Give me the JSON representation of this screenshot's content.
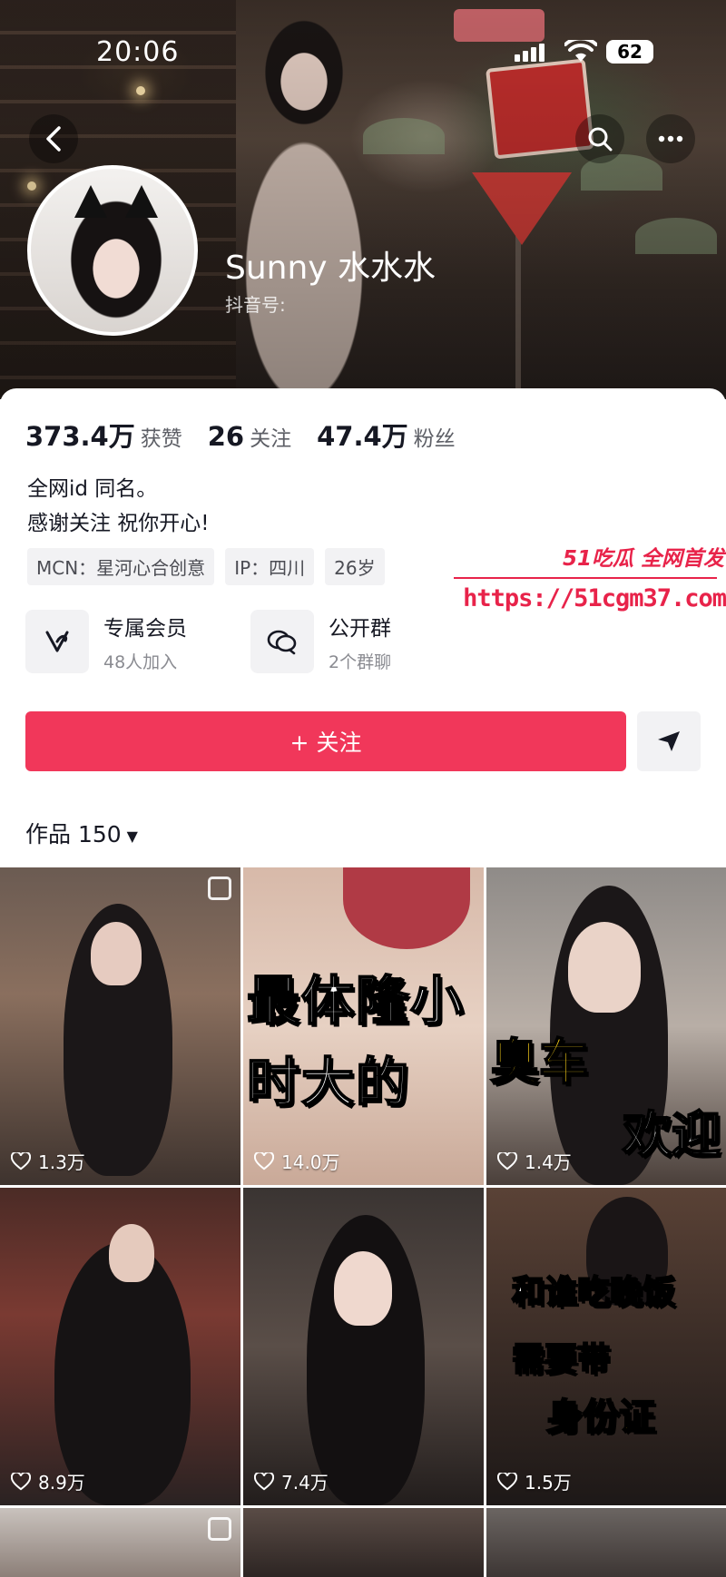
{
  "status_bar": {
    "time": "20:06",
    "battery": "62"
  },
  "profile": {
    "name": "Sunny 水水水",
    "douyin_id_label": "抖音号:",
    "stats": [
      {
        "value": "373.4万",
        "label": "获赞"
      },
      {
        "value": "26",
        "label": "关注"
      },
      {
        "value": "47.4万",
        "label": "粉丝"
      }
    ],
    "bio_lines": [
      "全网id 同名。",
      "感谢关注 祝你开心!"
    ],
    "tags": [
      "MCN：星河心合创意",
      "IP：四川",
      "26岁"
    ],
    "features": [
      {
        "title": "专属会员",
        "subtitle": "48人加入",
        "icon": "heart-v-icon"
      },
      {
        "title": "公开群",
        "subtitle": "2个群聊",
        "icon": "chat-bubbles-icon"
      }
    ],
    "follow_label": "+ 关注",
    "works_label": "作品 150"
  },
  "watermark": {
    "title": "51吃瓜 全网首发",
    "url": "https://51cgm37.com"
  },
  "videos": [
    {
      "likes": "1.3万",
      "overlay": ""
    },
    {
      "likes": "14.0万",
      "overlay": "最体隆小 时大的"
    },
    {
      "likes": "1.4万",
      "overlay": "臭车 欢迎"
    },
    {
      "likes": "8.9万",
      "overlay": ""
    },
    {
      "likes": "7.4万",
      "overlay": ""
    },
    {
      "likes": "1.5万",
      "overlay": "和谁吃晚饭 需要带 身份证"
    }
  ],
  "colors": {
    "accent": "#f1375a",
    "watermark": "#e8234a"
  }
}
